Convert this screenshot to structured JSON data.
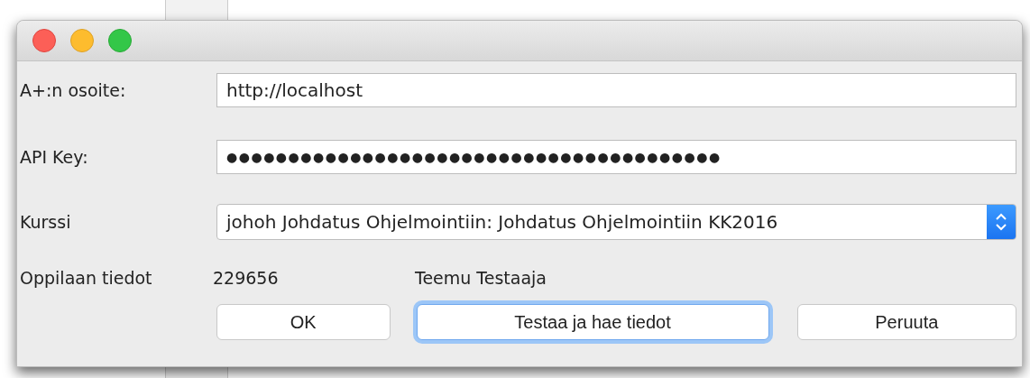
{
  "form": {
    "rows": [
      {
        "kind": "text",
        "label": "A+:n osoite:",
        "value": "http://localhost"
      },
      {
        "kind": "password",
        "label": "API Key:",
        "value": "●●●●●●●●●●●●●●●●●●●●●●●●●●●●●●●●●●●●●●●●"
      },
      {
        "kind": "select",
        "label": "Kurssi",
        "value": "johoh Johdatus Ohjelmointiin: Johdatus Ohjelmointiin KK2016"
      }
    ]
  },
  "student": {
    "label": "Oppilaan tiedot",
    "id": "229656",
    "name": "Teemu Testaaja"
  },
  "buttons": [
    {
      "label": "OK",
      "focused": false
    },
    {
      "label": "Testaa ja hae tiedot",
      "focused": true
    },
    {
      "label": "Peruuta",
      "focused": false
    }
  ]
}
